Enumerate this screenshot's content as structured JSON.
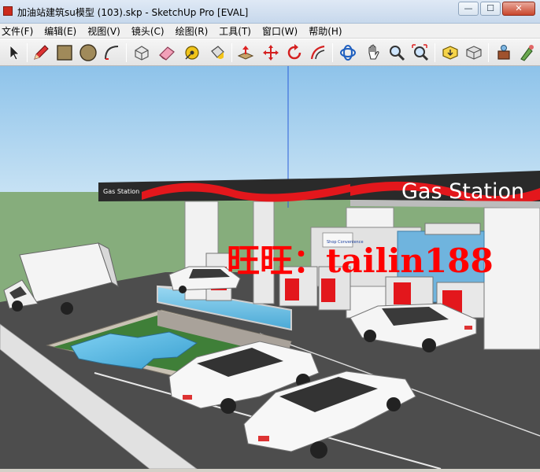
{
  "window": {
    "title": "加油站建筑su模型  (103).skp - SketchUp Pro [EVAL]",
    "minimize_glyph": "—",
    "maximize_glyph": "☐",
    "close_glyph": "✕"
  },
  "menu": [
    {
      "id": "file",
      "label": "文件(F)"
    },
    {
      "id": "edit",
      "label": "编辑(E)"
    },
    {
      "id": "view",
      "label": "视图(V)"
    },
    {
      "id": "camera",
      "label": "镜头(C)"
    },
    {
      "id": "draw",
      "label": "绘图(R)"
    },
    {
      "id": "tools",
      "label": "工具(T)"
    },
    {
      "id": "window",
      "label": "窗口(W)"
    },
    {
      "id": "help",
      "label": "帮助(H)"
    }
  ],
  "toolbar": {
    "tools": [
      {
        "id": "select",
        "icon": "arrow-cursor-icon"
      },
      {
        "id": "line",
        "icon": "pencil-icon"
      },
      {
        "id": "rectangle",
        "icon": "rectangle-icon"
      },
      {
        "id": "circle",
        "icon": "circle-icon"
      },
      {
        "id": "arc",
        "icon": "arc-icon"
      },
      {
        "id": "make-component",
        "icon": "component-icon"
      },
      {
        "id": "eraser",
        "icon": "eraser-icon"
      },
      {
        "id": "tape-measure",
        "icon": "tape-measure-icon"
      },
      {
        "id": "paint-bucket",
        "icon": "paint-bucket-icon"
      },
      {
        "id": "push-pull",
        "icon": "push-pull-icon"
      },
      {
        "id": "move",
        "icon": "move-icon"
      },
      {
        "id": "rotate",
        "icon": "rotate-icon"
      },
      {
        "id": "offset",
        "icon": "offset-icon"
      },
      {
        "id": "orbit",
        "icon": "orbit-icon"
      },
      {
        "id": "pan",
        "icon": "pan-hand-icon"
      },
      {
        "id": "zoom",
        "icon": "zoom-icon"
      },
      {
        "id": "zoom-extents",
        "icon": "zoom-extents-icon"
      },
      {
        "id": "get-models",
        "icon": "get-models-icon"
      },
      {
        "id": "share-model",
        "icon": "share-model-icon"
      },
      {
        "id": "components",
        "icon": "components-panel-icon"
      },
      {
        "id": "extension",
        "icon": "extension-icon"
      }
    ]
  },
  "scene": {
    "canopy_sign_text": "Gas Station",
    "small_sign_text": "Gas Station",
    "shop_sign_text": "Shop Convenience",
    "watermark": "旺旺：tailin188",
    "colors": {
      "sky": "#9cc9ea",
      "ground": "#86ad7c",
      "road": "#505050",
      "canopy_dark": "#2a2a2a",
      "accent_red": "#e3171c",
      "watermark_red": "#ff0000",
      "water": "#5bb7e0"
    }
  }
}
